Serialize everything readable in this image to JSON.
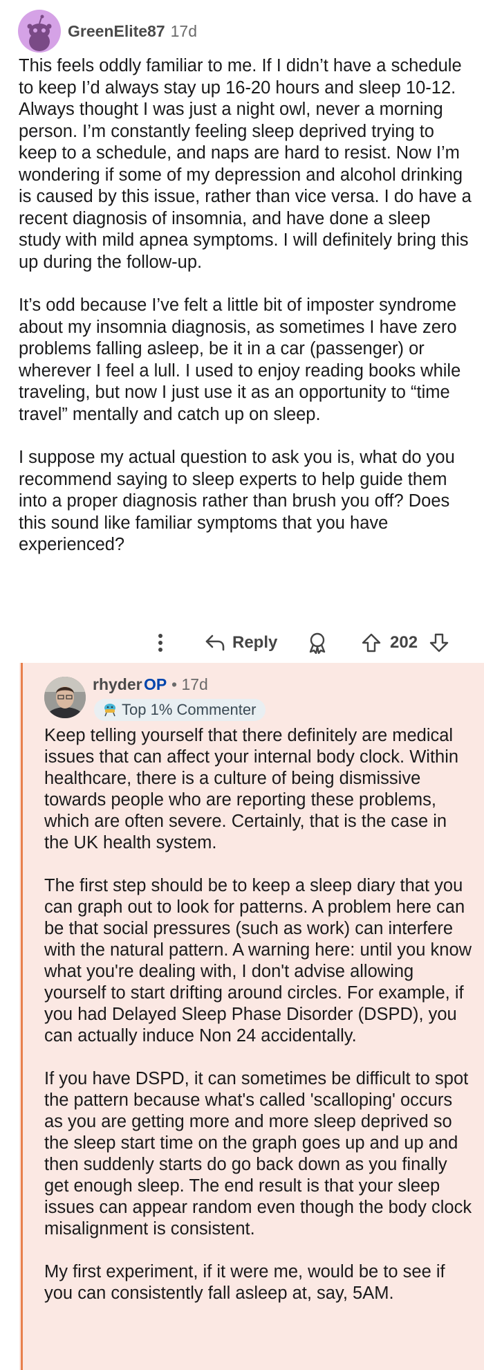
{
  "comment": {
    "username": "GreenElite87",
    "age": "17d",
    "paragraphs": [
      "This feels oddly familiar to me. If I didn’t have a schedule to keep I’d always stay up 16-20 hours and sleep 10-12. Always thought I was just a night owl, never a morning person. I’m constantly feeling sleep deprived trying to keep to a schedule, and naps are hard to resist. Now I’m wondering if some of my depression and alcohol drinking is caused by this issue, rather than vice versa. I do have a recent diagnosis of insomnia, and have done a sleep study with mild apnea symptoms. I will definitely bring this up during the follow-up.",
      "It’s odd because I’ve felt a little bit of imposter syndrome about my insomnia diagnosis, as sometimes I have zero problems falling asleep, be it in a car (passenger) or wherever I feel a lull. I used to enjoy reading books while traveling, but now I just use it as an opportunity to “time travel” mentally and catch up on sleep.",
      "I suppose my actual question to ask you is, what do you recommend saying to sleep experts to help guide them into a proper diagnosis rather than brush you off? Does this sound like familiar symptoms that you have experienced?"
    ],
    "actions": {
      "reply_label": "Reply",
      "score": "202"
    }
  },
  "reply": {
    "username": "rhyder",
    "op_label": "OP",
    "age": "• 17d",
    "badge": "Top 1% Commenter",
    "paragraphs": [
      "Keep telling yourself that there definitely are medical issues that can affect your internal body clock. Within healthcare, there is a culture of being dismissive towards people who are reporting these problems, which are often severe. Certainly, that is the case in the UK health system.",
      "The first step should be to keep a sleep diary that you can graph out to look for patterns. A problem here can be that social pressures (such as work) can interfere with the natural pattern. A warning here: until you know what you're dealing with, I don't advise allowing yourself to start drifting around circles. For example, if you had Delayed Sleep Phase Disorder (DSPD), you can actually induce Non 24 accidentally.",
      "If you have DSPD, it can sometimes be difficult to spot the pattern because what's called 'scalloping' occurs as you are getting more and more sleep deprived so the sleep start time on the graph goes up and up and then suddenly starts do go back down as you finally get enough sleep. The end result is that your sleep issues can appear random even though the body clock misalignment is consistent.",
      "My first experiment, if it were me, would be to see if you can consistently fall asleep at, say, 5AM."
    ]
  },
  "colors": {
    "reply_background": "#fbe8e3",
    "thread_line": "#e8804d",
    "op_label": "#0045ac",
    "avatar1": "#d5a2e6"
  },
  "icons": [
    "snoo-avatar-icon",
    "more-options-icon",
    "reply-arrow-icon",
    "award-icon",
    "upvote-icon",
    "downvote-icon",
    "commenter-badge-icon"
  ]
}
